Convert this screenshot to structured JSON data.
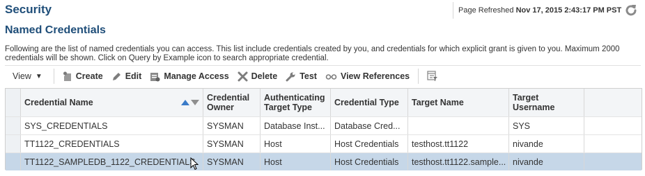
{
  "header": {
    "title": "Security",
    "refresh_label": "Page Refreshed",
    "refresh_time": "Nov 17, 2015 2:43:17 PM PST"
  },
  "section": {
    "title": "Named Credentials",
    "description": "Following are the list of named credentials you can access. This list include credentials created by you, and credentials for which explicit grant is given to you. Maximum 2000 credentials will be shown. Click on Query by Example icon to search appropriate credential."
  },
  "toolbar": {
    "view": "View",
    "create": "Create",
    "edit": "Edit",
    "manage_access": "Manage Access",
    "delete": "Delete",
    "test": "Test",
    "view_references": "View References"
  },
  "table": {
    "columns": [
      "Credential Name",
      "Credential Owner",
      "Authenticating Target Type",
      "Credential Type",
      "Target Name",
      "Target Username"
    ],
    "rows": [
      [
        "SYS_CREDENTIALS",
        "SYSMAN",
        "Database Inst...",
        "Database Cred...",
        "",
        "SYS"
      ],
      [
        "TT1122_CREDENTIALS",
        "SYSMAN",
        "Host",
        "Host Credentials",
        "testhost.tt1122",
        "nivande"
      ],
      [
        "TT1122_SAMPLEDB_1122_CREDENTIALS",
        "SYSMAN",
        "Host",
        "Host Credentials",
        "testhost.tt1122.sample...",
        "nivande"
      ]
    ],
    "selected_row": 2
  },
  "colors": {
    "title": "#1f4e79",
    "selected_row": "#c6d7e8",
    "sort_active": "#3a7bc8"
  }
}
